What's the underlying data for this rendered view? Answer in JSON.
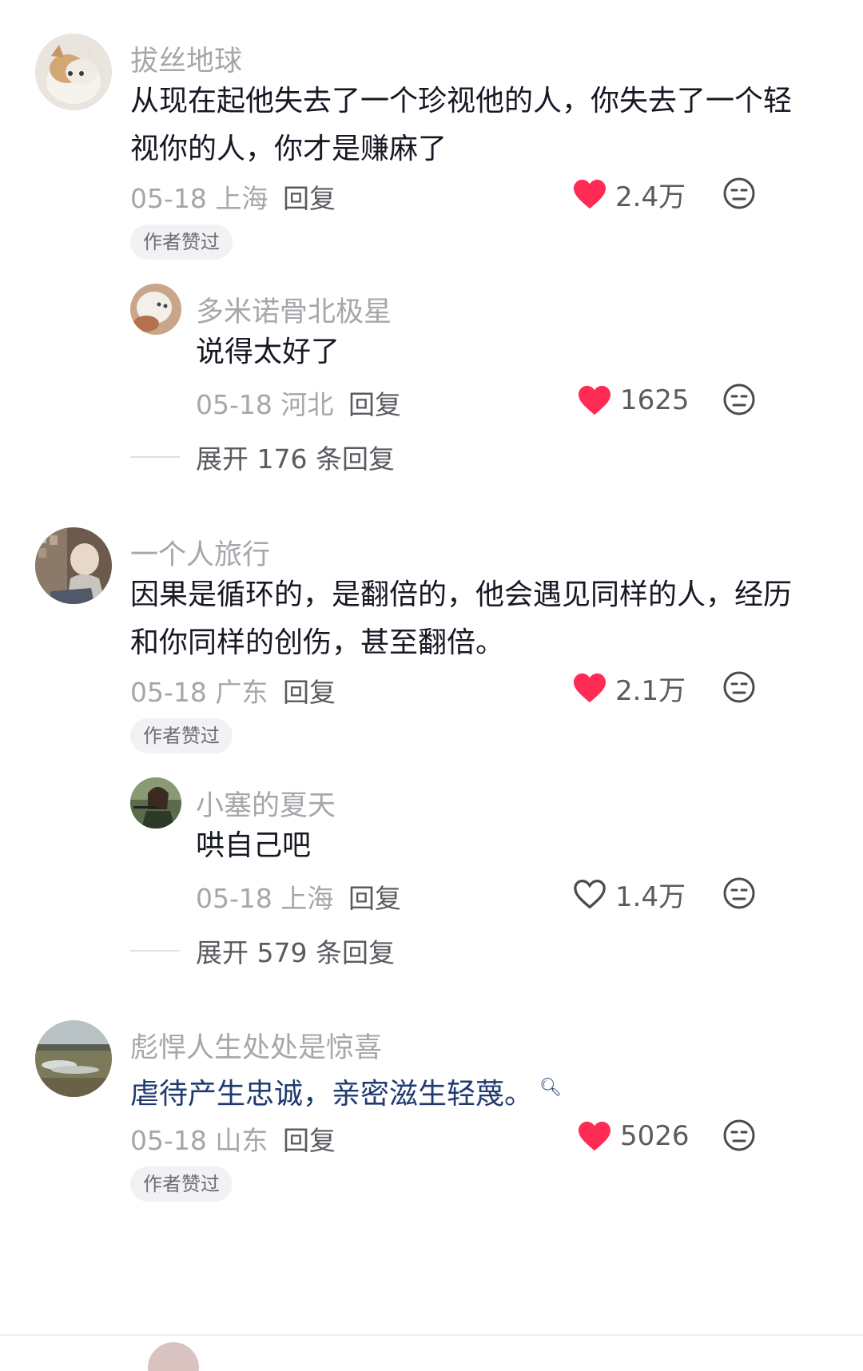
{
  "comments": [
    {
      "username": "拔丝地球",
      "text": "从现在起他失去了一个珍视他的人，你失去了一个轻视你的人，你才是赚麻了",
      "meta": "05-18 上海",
      "reply_label": "回复",
      "likes": "2.4万",
      "liked": true,
      "author_badge": "作者赞过",
      "reply": {
        "username": "多米诺骨北极星",
        "text": "说得太好了",
        "meta": "05-18 河北",
        "reply_label": "回复",
        "likes": "1625",
        "liked": true
      },
      "expand_label": "展开 176 条回复"
    },
    {
      "username": "一个人旅行",
      "text": "因果是循环的，是翻倍的，他会遇见同样的人，经历和你同样的创伤，甚至翻倍。",
      "meta": "05-18 广东",
      "reply_label": "回复",
      "likes": "2.1万",
      "liked": true,
      "author_badge": "作者赞过",
      "reply": {
        "username": "小塞的夏天",
        "text": "哄自己吧",
        "meta": "05-18 上海",
        "reply_label": "回复",
        "likes": "1.4万",
        "liked": false
      },
      "expand_label": "展开 579 条回复"
    },
    {
      "username": "彪悍人生处处是惊喜",
      "text": "虐待产生忠诚，亲密滋生轻蔑。",
      "meta": "05-18 山东",
      "reply_label": "回复",
      "likes": "5026",
      "liked": true,
      "author_badge": "作者赞过"
    }
  ],
  "icons": {
    "like_filled": "heart-filled-icon",
    "like_outline": "heart-outline-icon",
    "dislike": "dislike-face-icon",
    "search_hint": "search-icon"
  },
  "colors": {
    "heart": "#fe2c55",
    "username": "#a6a6ab",
    "text": "#161823",
    "link_text": "#1f3a70"
  }
}
